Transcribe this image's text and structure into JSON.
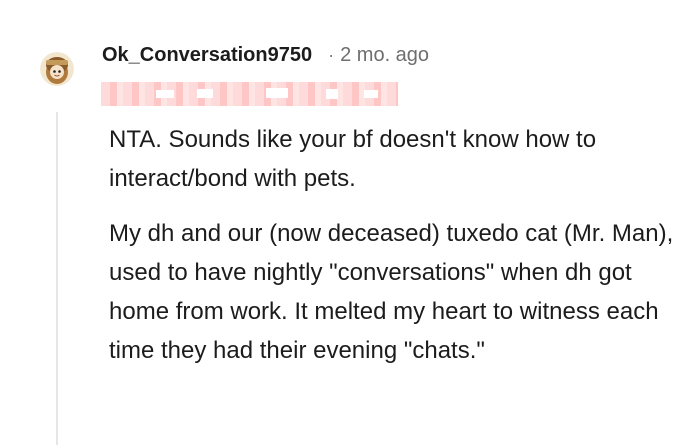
{
  "comment": {
    "username": "Ok_Conversation9750",
    "separator": "·",
    "time_ago": "2 mo. ago",
    "paragraphs": [
      "NTA. Sounds like your bf doesn't know how to interact/bond with pets.",
      "My dh and our (now deceased) tuxedo cat (Mr. Man), used to have nightly \"conversations\" when dh got home from work. It melted my heart to witness each time they had their evening \"chats.\""
    ]
  },
  "colors": {
    "username": "#1c1c1c",
    "meta": "#6e6e6e",
    "body_text": "#1c1c1c",
    "thread_line": "#e6e6e6",
    "redaction": "#ffcccc"
  },
  "icons": {
    "avatar": "snoo-avatar-icon"
  }
}
